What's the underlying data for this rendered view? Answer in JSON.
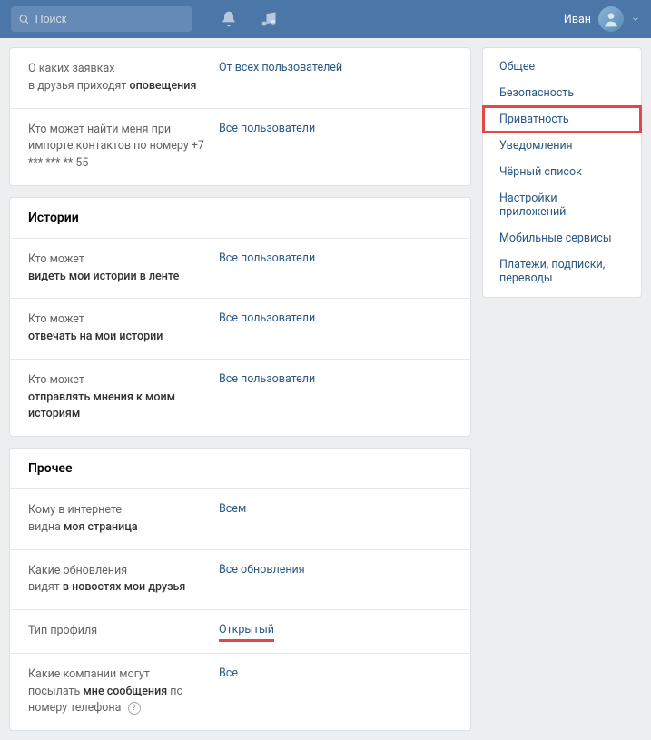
{
  "header": {
    "search_placeholder": "Поиск",
    "user_name": "Иван"
  },
  "sections": {
    "friends": {
      "rows": [
        {
          "label_light1": "О каких заявках",
          "label_bold": "оповещения",
          "label_light2": "в друзья приходят ",
          "value": "От всех пользователей"
        },
        {
          "label_text": "Кто может найти меня при импорте контактов по номеру +7 *** *** ** 55",
          "value": "Все пользователи"
        }
      ]
    },
    "stories": {
      "title": "Истории",
      "rows": [
        {
          "label_light": "Кто может",
          "label_bold": "видеть мои истории в ленте",
          "value": "Все пользователи"
        },
        {
          "label_light": "Кто может",
          "label_bold": "отвечать на мои истории",
          "value": "Все пользователи"
        },
        {
          "label_light": "Кто может",
          "label_bold": "отправлять мнения к моим историям",
          "value": "Все пользователи"
        }
      ]
    },
    "other": {
      "title": "Прочее",
      "rows": [
        {
          "label_light1": "Кому в интернете",
          "label_light2": "видна ",
          "label_bold": "моя страница",
          "value": "Всем"
        },
        {
          "label_light1": "Какие обновления",
          "label_light2": "видят ",
          "label_bold": "в новостях мои друзья",
          "value": "Все обновления"
        },
        {
          "label_text": "Тип профиля",
          "value": "Открытый",
          "highlight": true
        },
        {
          "label_light1": "Какие компании могут",
          "label_light2": "посылать ",
          "label_bold": "мне сообщения",
          "label_after": " по номеру телефона",
          "value": "Все",
          "help": true
        }
      ]
    }
  },
  "sidebar": {
    "items": [
      {
        "label": "Общее"
      },
      {
        "label": "Безопасность"
      },
      {
        "label": "Приватность",
        "highlighted": true
      },
      {
        "label": "Уведомления"
      },
      {
        "label": "Чёрный список"
      },
      {
        "label": "Настройки приложений"
      },
      {
        "label": "Мобильные сервисы"
      },
      {
        "label": "Платежи, подписки, переводы"
      }
    ]
  }
}
